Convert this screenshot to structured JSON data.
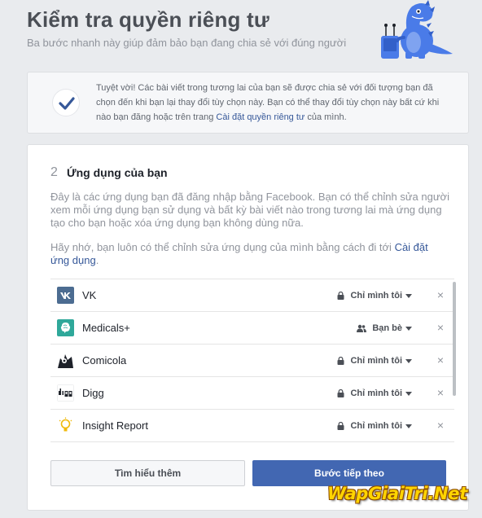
{
  "header": {
    "title": "Kiểm tra quyền riêng tư",
    "subtitle": "Ba bước nhanh này giúp đảm bảo bạn đang chia sẻ với đúng người"
  },
  "notice": {
    "text_before_link": "Tuyệt vời! Các bài viết trong tương lai của bạn sẽ được chia sẻ với đối tượng bạn đã chọn đến khi bạn lại thay đổi tùy chọn này. Bạn có thể thay đổi tùy chọn này bất cứ khi nào bạn đăng hoặc trên trang ",
    "link": "Cài đặt quyền riêng tư",
    "text_after_link": " của mình."
  },
  "section": {
    "step": "2",
    "title": "Ứng dụng của bạn",
    "description": "Đây là các ứng dụng bạn đã đăng nhập bằng Facebook. Bạn có thể chỉnh sửa người xem mỗi ứng dụng bạn sử dụng và bất kỳ bài viết nào trong tương lai mà ứng dụng tạo cho bạn hoặc xóa ứng dụng bạn không dùng nữa.",
    "hint_text": "Hãy nhớ, bạn luôn có thể chỉnh sửa ứng dụng của mình bằng cách đi tới ",
    "hint_link": "Cài đặt ứng dụng",
    "hint_end": "."
  },
  "apps": [
    {
      "name": "VK",
      "audience": "Chỉ mình tôi",
      "audience_icon": "lock-icon",
      "icon": "vk-app-icon",
      "remove": "×"
    },
    {
      "name": "Medicals+",
      "audience": "Bạn bè",
      "audience_icon": "friends-icon",
      "icon": "medicals-app-icon",
      "remove": "×"
    },
    {
      "name": "Comicola",
      "audience": "Chỉ mình tôi",
      "audience_icon": "lock-icon",
      "icon": "comicola-app-icon",
      "remove": "×"
    },
    {
      "name": "Digg",
      "audience": "Chỉ mình tôi",
      "audience_icon": "lock-icon",
      "icon": "digg-app-icon",
      "remove": "×"
    },
    {
      "name": "Insight Report",
      "audience": "Chỉ mình tôi",
      "audience_icon": "lock-icon",
      "icon": "insight-app-icon",
      "remove": "×"
    }
  ],
  "buttons": {
    "learn_more": "Tìm hiểu thêm",
    "next_step": "Bước tiếp theo"
  },
  "watermark": "WapGiaiTri.Net",
  "colors": {
    "brand": "#4267b2",
    "link": "#365899",
    "background": "#e9ebee",
    "dino": "#4a7be8"
  }
}
